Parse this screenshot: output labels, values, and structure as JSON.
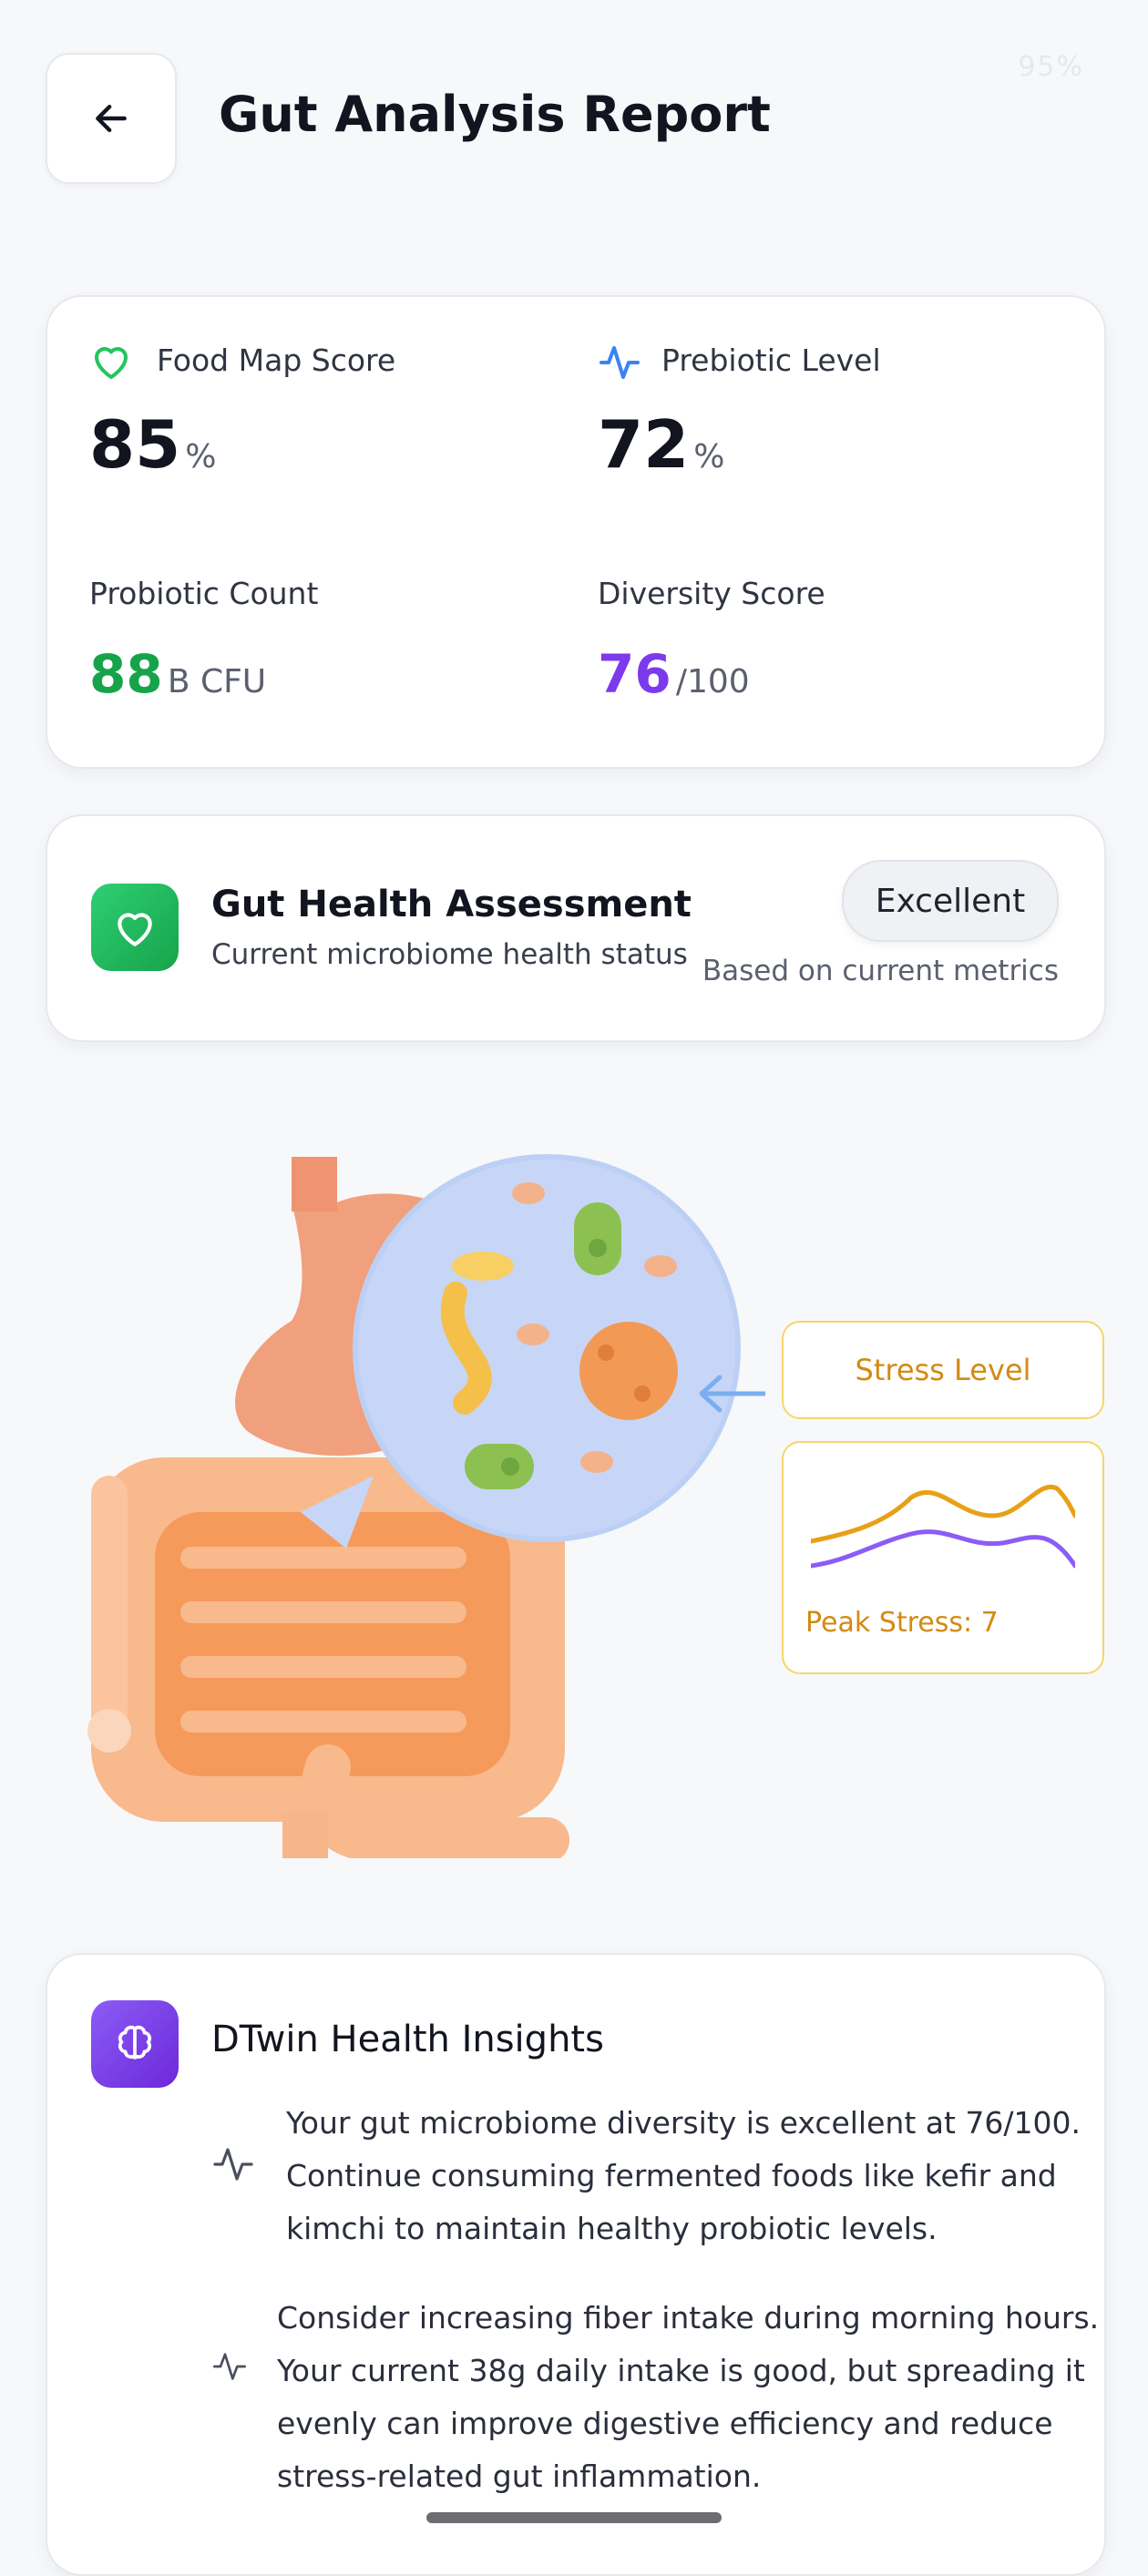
{
  "status_bar": {
    "text": "95%"
  },
  "header": {
    "title": "Gut Analysis Report"
  },
  "metrics": {
    "food_map": {
      "label": "Food Map Score",
      "value": "85",
      "unit": "%"
    },
    "prebiotic": {
      "label": "Prebiotic Level",
      "value": "72",
      "unit": "%"
    },
    "probiotic": {
      "label": "Probiotic Count",
      "value": "88",
      "unit": "B CFU"
    },
    "diversity": {
      "label": "Diversity Score",
      "value": "76",
      "unit": "/100"
    }
  },
  "assessment": {
    "title": "Gut Health Assessment",
    "subtitle": "Current microbiome health status",
    "badge": "Excellent",
    "note": "Based on current metrics"
  },
  "stress": {
    "label": "Stress Level",
    "peak": "Peak Stress: 7"
  },
  "insights": {
    "title": "DTwin Health Insights",
    "items": [
      {
        "lines": [
          "Your gut microbiome diversity is excellent at 76/100.",
          "Continue consuming fermented foods like kefir and",
          "kimchi to maintain healthy probiotic levels."
        ]
      },
      {
        "lines": [
          "Consider increasing fiber intake during morning hours.",
          "Your current 38g daily intake is good, but spreading it",
          "evenly can improve digestive efficiency and reduce",
          "stress-related gut inflammation."
        ]
      }
    ]
  },
  "colors": {
    "green": "#16a34a",
    "purple": "#7c3aed",
    "blue": "#3b82f6",
    "amber": "#d38a12"
  }
}
